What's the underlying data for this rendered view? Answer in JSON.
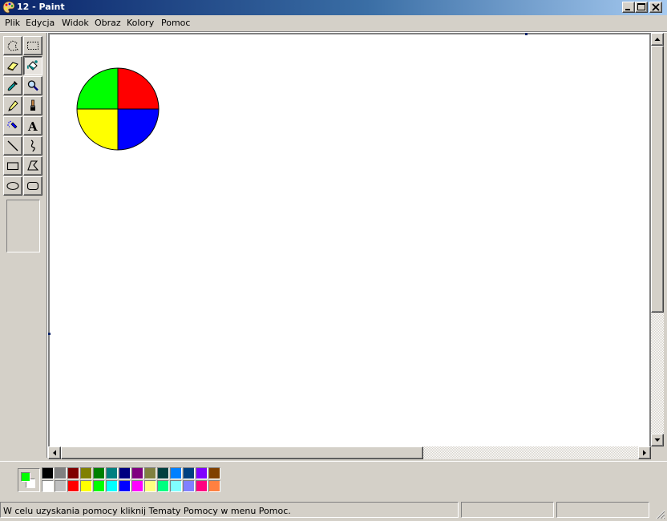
{
  "window": {
    "title": "12 - Paint",
    "app_icon": "paint-palette-icon",
    "caption_buttons": [
      "minimize-icon",
      "maximize-icon",
      "close-icon"
    ]
  },
  "menu": {
    "items": [
      "Plik",
      "Edycja",
      "Widok",
      "Obraz",
      "Kolory",
      "Pomoc"
    ]
  },
  "toolbox": {
    "tools": [
      {
        "name": "free-form-select",
        "icon": "free-select-icon",
        "pressed": false
      },
      {
        "name": "select",
        "icon": "rect-select-icon",
        "pressed": false
      },
      {
        "name": "eraser",
        "icon": "eraser-icon",
        "pressed": false
      },
      {
        "name": "fill-with-color",
        "icon": "paint-bucket-icon",
        "pressed": true
      },
      {
        "name": "pick-color",
        "icon": "eyedropper-icon",
        "pressed": false
      },
      {
        "name": "magnifier",
        "icon": "magnifier-icon",
        "pressed": false
      },
      {
        "name": "pencil",
        "icon": "pencil-icon",
        "pressed": false
      },
      {
        "name": "brush",
        "icon": "brush-icon",
        "pressed": false
      },
      {
        "name": "airbrush",
        "icon": "airbrush-icon",
        "pressed": false
      },
      {
        "name": "text",
        "icon": "text-icon",
        "label": "A",
        "pressed": false
      },
      {
        "name": "line",
        "icon": "line-icon",
        "pressed": false
      },
      {
        "name": "curve",
        "icon": "curve-icon",
        "pressed": false
      },
      {
        "name": "rectangle",
        "icon": "rectangle-icon",
        "pressed": false
      },
      {
        "name": "polygon",
        "icon": "polygon-icon",
        "pressed": false
      },
      {
        "name": "ellipse",
        "icon": "ellipse-icon",
        "pressed": false
      },
      {
        "name": "rounded-rectangle",
        "icon": "rounded-rectangle-icon",
        "pressed": false
      }
    ]
  },
  "canvas": {
    "background": "#ffffff",
    "drawing": {
      "shape": "circle divided into four quadrants",
      "quadrant_colors": {
        "top_left": "#00ff00",
        "top_right": "#ff0000",
        "bottom_left": "#ffff00",
        "bottom_right": "#0000ff"
      },
      "outline": "#000000"
    }
  },
  "colors": {
    "foreground": "#00ff00",
    "background": "#ffffff",
    "palette_top": [
      "#000000",
      "#808080",
      "#800000",
      "#808000",
      "#008000",
      "#008080",
      "#000080",
      "#800080",
      "#808040",
      "#004040",
      "#0080ff",
      "#004080",
      "#8000ff",
      "#804000"
    ],
    "palette_bottom": [
      "#ffffff",
      "#c0c0c0",
      "#ff0000",
      "#ffff00",
      "#00ff00",
      "#00ffff",
      "#0000ff",
      "#ff00ff",
      "#ffff80",
      "#00ff80",
      "#80ffff",
      "#8080ff",
      "#ff0080",
      "#ff8040"
    ]
  },
  "status": {
    "help_text": "W celu uzyskania pomocy kliknij Tematy Pomocy w menu Pomoc.",
    "coordinates": "",
    "size": ""
  }
}
